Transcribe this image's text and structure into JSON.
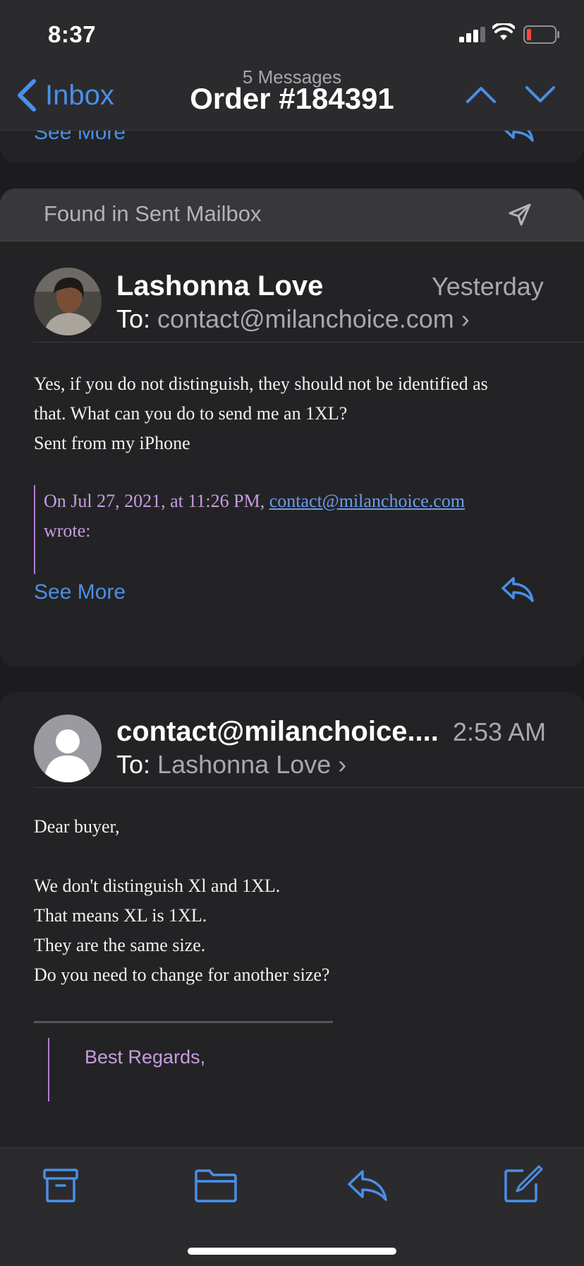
{
  "status_bar": {
    "time": "8:37"
  },
  "nav": {
    "back_label": "Inbox",
    "subtitle": "5 Messages",
    "title": "Order #184391"
  },
  "thread": {
    "see_more": "See More",
    "found_in": "Found in Sent Mailbox",
    "message1": {
      "sender": "Lashonna Love",
      "date": "Yesterday",
      "to_label": "To:",
      "to": "contact@milanchoice.com",
      "body_line1": "Yes, if you do not distinguish, they should not be identified as",
      "body_line2": "that. What can you do to send me an 1XL?",
      "signature": "Sent from my iPhone",
      "quote_prefix": "On Jul 27, 2021, at 11:26 PM,",
      "quote_link": "contact@milanchoice.com",
      "quote_suffix": "wrote:"
    },
    "message2": {
      "sender": "contact@milanchoice....",
      "time": "2:53 AM",
      "to_label": "To:",
      "to": "Lashonna Love",
      "greeting": "Dear buyer,",
      "line1": "We don't distinguish Xl and 1XL.",
      "line2": "That means XL is 1XL.",
      "line3": "They are the same size.",
      "line4": "Do you need to change for another size?",
      "regards": "Best Regards,"
    }
  },
  "icons": {
    "back": "chevron-left-icon",
    "prev": "chevron-up-icon",
    "next": "chevron-down-icon",
    "reply": "reply-icon",
    "sent": "paper-plane-icon",
    "archive": "archive-box-icon",
    "folder": "folder-icon",
    "compose": "compose-icon"
  },
  "colors": {
    "accent": "#4a8fe7",
    "quote": "#c79ce0",
    "background": "#1c1c1e"
  }
}
